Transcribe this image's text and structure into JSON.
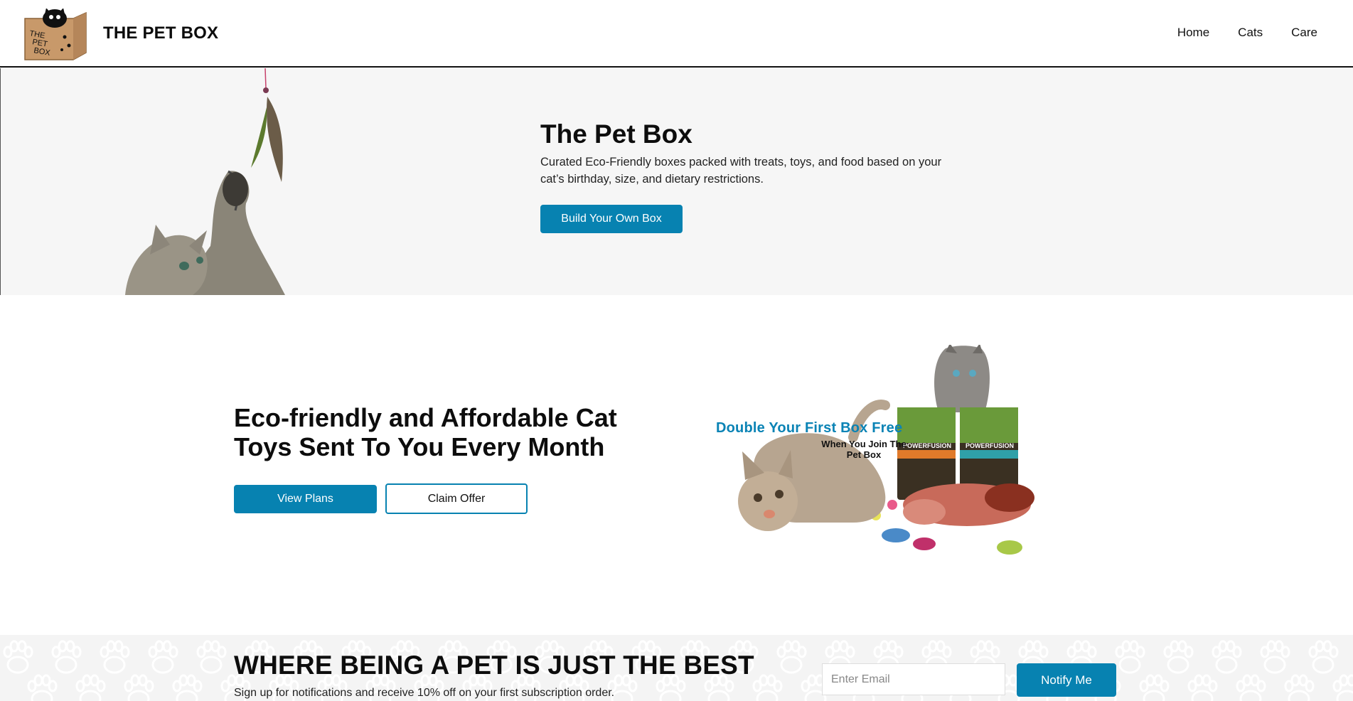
{
  "header": {
    "brand": "THE PET BOX",
    "logo_text": [
      "THE",
      "PET",
      "BOX"
    ],
    "nav": [
      "Home",
      "Cats",
      "Care"
    ]
  },
  "hero": {
    "title": "The Pet Box",
    "description": "Curated Eco-Friendly boxes packed with treats, toys, and food based on your cat’s birthday, size, and dietary restrictions.",
    "cta": "Build Your Own Box"
  },
  "promo": {
    "title": "Eco-friendly and Affordable Cat Toys Sent To You Every Month",
    "view_plans": "View Plans",
    "claim_offer": "Claim Offer",
    "image_headline": "Double Your First Box Free",
    "image_subline": "When You Join The Pet Box",
    "bag_label": "POWERFUSION"
  },
  "signup": {
    "title": "WHERE BEING A PET IS JUST THE BEST",
    "subtitle": "Sign up for notifications and receive 10% off on your first subscription order.",
    "email_placeholder": "Enter Email",
    "button": "Notify Me"
  },
  "colors": {
    "accent": "#0782b1",
    "hero_bg": "#f6f6f6",
    "band_bg": "#f4f4f4"
  }
}
